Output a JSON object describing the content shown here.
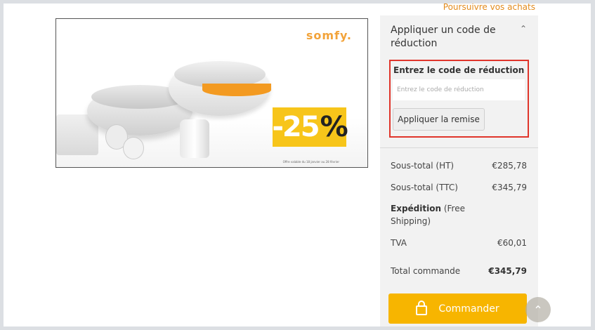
{
  "header": {
    "continue_shopping": "Poursuivre vos achats"
  },
  "banner": {
    "brand": "somfy.",
    "promo_number": "-25",
    "promo_percent": "%",
    "fine_print": "Offre valable du 18 janvier au 28 février"
  },
  "discount": {
    "heading": "Appliquer un code de réduction",
    "label": "Entrez le code de réduction",
    "placeholder": "Entrez le code de réduction",
    "apply_label": "Appliquer la remise",
    "expanded": true
  },
  "totals": {
    "subtotal_ht_label": "Sous-total (HT)",
    "subtotal_ht_value": "€285,78",
    "subtotal_ttc_label": "Sous-total (TTC)",
    "subtotal_ttc_value": "€345,79",
    "shipping_label": "Expédition",
    "shipping_note": "(Free Shipping)",
    "tva_label": "TVA",
    "tva_value": "€60,01",
    "order_total_label": "Total commande",
    "order_total_value": "€345,79"
  },
  "checkout": {
    "label": "Commander"
  },
  "colors": {
    "accent": "#f7b500",
    "highlight_border": "#e0352b",
    "link": "#e38b1c"
  },
  "icons": {
    "lock": "lock-icon",
    "chevron": "chevron-up-icon",
    "scroll_top": "arrow-up-icon"
  }
}
